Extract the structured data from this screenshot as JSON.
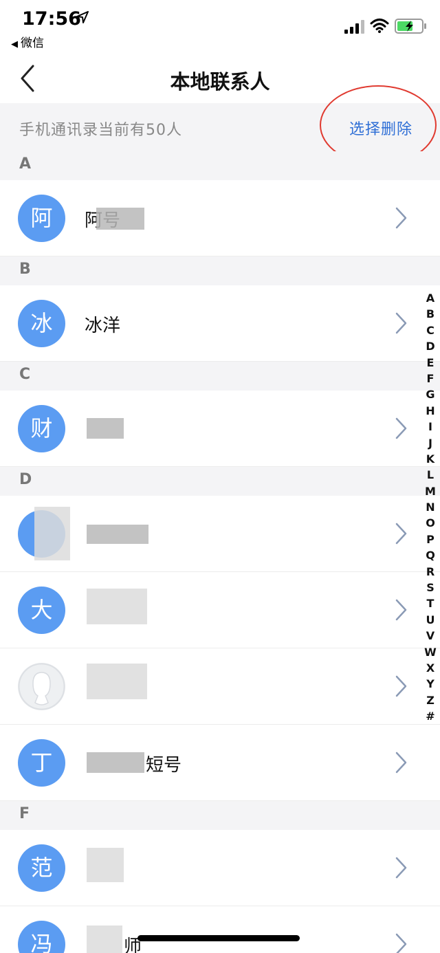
{
  "status": {
    "time": "17:56",
    "back_app": "微信"
  },
  "nav": {
    "title": "本地联系人"
  },
  "info": {
    "count_text": "手机通讯录当前有50人",
    "select_delete": "选择删除"
  },
  "sections": [
    {
      "letter": "A",
      "contacts": [
        {
          "avatar": "阿",
          "name": "阿号"
        }
      ]
    },
    {
      "letter": "B",
      "contacts": [
        {
          "avatar": "冰",
          "name": "冰洋"
        }
      ]
    },
    {
      "letter": "C",
      "contacts": [
        {
          "avatar": "财",
          "name": ""
        }
      ]
    },
    {
      "letter": "D",
      "contacts": [
        {
          "avatar": "",
          "name": ""
        },
        {
          "avatar": "大",
          "name": ""
        },
        {
          "avatar": "",
          "name": ""
        },
        {
          "avatar": "丁",
          "name": "短号"
        }
      ]
    },
    {
      "letter": "F",
      "contacts": [
        {
          "avatar": "范",
          "name": ""
        },
        {
          "avatar": "冯",
          "name": "师"
        }
      ]
    }
  ],
  "index": [
    "A",
    "B",
    "C",
    "D",
    "E",
    "F",
    "G",
    "H",
    "I",
    "J",
    "K",
    "L",
    "M",
    "N",
    "O",
    "P",
    "Q",
    "R",
    "S",
    "T",
    "U",
    "V",
    "W",
    "X",
    "Y",
    "Z",
    "#"
  ],
  "colors": {
    "accent": "#2f6fd6",
    "avatar": "#5b9cf2",
    "annotation": "#e03a30"
  }
}
